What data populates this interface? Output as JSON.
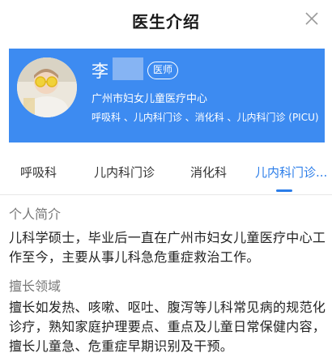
{
  "header": {
    "title": "医生介绍"
  },
  "doctor": {
    "name": "李",
    "role_badge": "医师",
    "hospital": "广州市妇女儿童医疗中心",
    "departments": "呼吸科 、儿内科门诊 、消化科 、儿内科门诊 (PICU)"
  },
  "tabs": [
    {
      "label": "呼吸科",
      "active": false
    },
    {
      "label": "儿内科门诊",
      "active": false
    },
    {
      "label": "消化科",
      "active": false
    },
    {
      "label": "儿内科门诊...",
      "active": true
    }
  ],
  "profile": {
    "title": "个人简介",
    "text": "儿科学硕士，毕业后一直在广州市妇女儿童医疗中心工作至今，主要从事儿科急危重症救治工作。"
  },
  "expertise": {
    "title": "擅长领域",
    "text": "擅长如发热、咳嗽、呕吐、腹泻等儿科常见病的规范化诊疗，熟知家庭护理要点、重点及儿童日常保健内容，擅长儿童急、危重症早期识别及干预。"
  },
  "colors": {
    "card_bg": "#3d8bf1",
    "accent": "#2b7de9"
  },
  "icons": {
    "close": "close-icon"
  }
}
